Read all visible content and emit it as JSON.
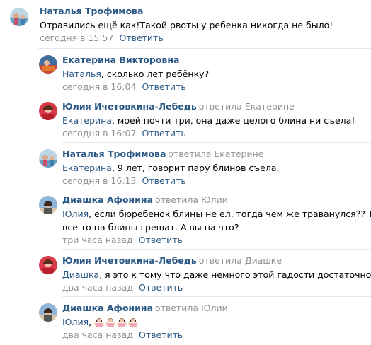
{
  "comments": [
    {
      "author": "Наталья Трофимова",
      "replied_to": "",
      "mention": "",
      "text": "Отравились ещё как!Такой рвоты у ребенка никогда не было!",
      "time": "сегодня в 15:57",
      "reply_label": "Ответить"
    },
    {
      "author": "Екатерина Викторовна",
      "replied_to": "",
      "mention": "Наталья",
      "text": ", сколько лет ребёнку?",
      "time": "сегодня в 16:04",
      "reply_label": "Ответить"
    },
    {
      "author": "Юлия Ичетовкина-Лебедь",
      "replied_to": "ответила Екатерине",
      "mention": "Екатерина",
      "text": ", моей почти три, она даже целого блина ни съела!",
      "time": "сегодня в 16:07",
      "reply_label": "Ответить"
    },
    {
      "author": "Наталья Трофимова",
      "replied_to": "ответила Екатерине",
      "mention": "Екатерина",
      "text": ", 9 лет, говорит пару блинов съела.",
      "time": "сегодня в 16:13",
      "reply_label": "Ответить"
    },
    {
      "author": "Диашка Афонина",
      "replied_to": "ответила Юлии",
      "mention": "Юлия",
      "text": ", если бюребенок блины не ел, тогда чем же траванулся?? Тут",
      "text2": "все то на блины грешат. А вы на что?",
      "time": "три часа назад",
      "reply_label": "Ответить"
    },
    {
      "author": "Юлия Ичетовкина-Лебедь",
      "replied_to": "ответила Диашке",
      "mention": "Диашка",
      "text": ", я это к тому что даже немного этой гадости достаточно",
      "time": "два часа назад",
      "reply_label": "Ответить"
    },
    {
      "author": "Диашка Афонина",
      "replied_to": "ответила Юлии",
      "mention": "Юлия",
      "text": ", ",
      "emoji": [
        "woman-gesturing-icon",
        "woman-gesturing-icon",
        "woman-gesturing-icon",
        "woman-gesturing-icon"
      ],
      "time": "два часа назад",
      "reply_label": "Ответить"
    }
  ],
  "colors": {
    "link": "#2a5885",
    "meta": "#939393",
    "divider": "#e7e8ec"
  }
}
